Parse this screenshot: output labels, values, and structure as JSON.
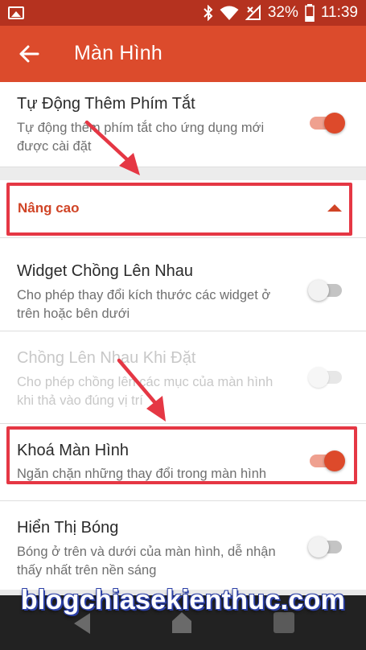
{
  "status_bar": {
    "battery": "32%",
    "time": "11:39",
    "icons": [
      "image-icon",
      "bluetooth-icon",
      "wifi-icon",
      "signal-no-data-icon",
      "battery-icon"
    ]
  },
  "app_bar": {
    "title": "Màn Hình",
    "back_icon": "arrow-left-icon"
  },
  "settings": {
    "shortcut": {
      "title": "Tự Động Thêm Phím Tắt",
      "summary": "Tự động thêm phím tắt cho ứng dụng mới được cài đặt",
      "enabled": true
    },
    "advanced_section": {
      "label": "Nâng cao",
      "caret_icon": "caret-up-icon"
    },
    "widget_overlap": {
      "title": "Widget Chồng Lên Nhau",
      "summary": "Cho phép thay đổi kích thước các widget ở trên hoặc bên dưới",
      "enabled": false
    },
    "overlap_on_drop": {
      "title": "Chồng Lên Nhau Khi Đặt",
      "summary": "Cho phép chồng lên các mục của màn hình khi thả vào đúng vị trí",
      "enabled": false,
      "disabled": true
    },
    "lock_screen": {
      "title": "Khoá Màn Hình",
      "summary": "Ngăn chặn những thay đổi trong màn hình",
      "enabled": true
    },
    "show_shadow": {
      "title": "Hiển Thị Bóng",
      "summary": "Bóng ở trên và dưới của màn hình, dễ nhận thấy nhất trên nền sáng",
      "enabled": false
    }
  },
  "watermark": "blogchiasekienthuc.com",
  "colors": {
    "accent": "#dc4b2c",
    "status_bar": "#b5321f",
    "highlight_box": "#e53744",
    "section_label": "#d04426"
  }
}
